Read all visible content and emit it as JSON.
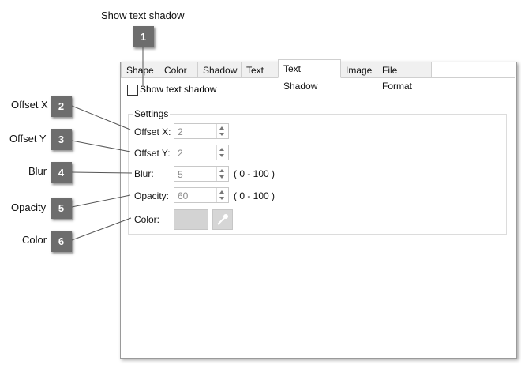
{
  "callout_title": "Show text shadow",
  "callouts": [
    {
      "number": "1",
      "label": ""
    },
    {
      "number": "2",
      "label": "Offset X"
    },
    {
      "number": "3",
      "label": "Offset Y"
    },
    {
      "number": "4",
      "label": "Blur"
    },
    {
      "number": "5",
      "label": "Opacity"
    },
    {
      "number": "6",
      "label": "Color"
    }
  ],
  "tabs": [
    "Shape",
    "Color",
    "Shadow",
    "Text",
    "Text Shadow",
    "Image",
    "File Format"
  ],
  "active_tab": "Text Shadow",
  "show_text_shadow": {
    "label": "Show text shadow",
    "checked": false
  },
  "settings": {
    "title": "Settings",
    "offset_x": {
      "label": "Offset X:",
      "value": "2"
    },
    "offset_y": {
      "label": "Offset Y:",
      "value": "2"
    },
    "blur": {
      "label": "Blur:",
      "value": "5",
      "range": "( 0 - 100 )"
    },
    "opacity": {
      "label": "Opacity:",
      "value": "60",
      "range": "( 0 - 100 )"
    },
    "color": {
      "label": "Color:",
      "swatch": "#d3d3d3"
    }
  },
  "colors": {
    "badge": "#6d6d6d",
    "disabled_text": "#8a8a8a"
  }
}
